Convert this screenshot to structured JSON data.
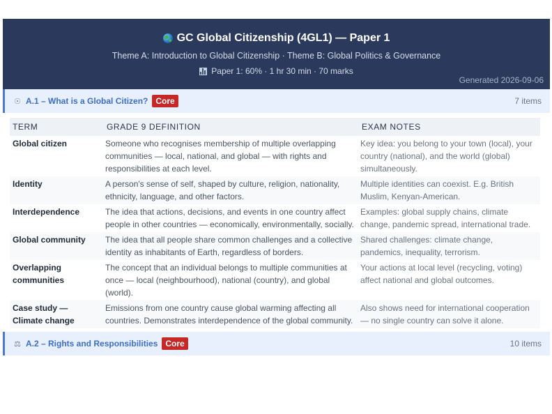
{
  "header": {
    "title": "GC Global Citizenship (4GL1) — Paper 1",
    "subtitle": "Theme A: Introduction to Global Citizenship · Theme B: Global Politics & Governance",
    "meta": "Paper 1: 60% · 1 hr 30 min · 70 marks",
    "generated": "Generated 2026-09-06",
    "title_icon": "globe-icon",
    "meta_icon": "bar-chart-icon"
  },
  "sections": [
    {
      "icon": "globe-meridian-icon",
      "title": "A.1 – What is a Global Citizen?",
      "badge": "Core",
      "count": "7 items"
    },
    {
      "icon": "scales-icon",
      "title": "A.2 – Rights and Responsibilities",
      "badge": "Core",
      "count": "10 items"
    }
  ],
  "table": {
    "headers": [
      "TERM",
      "GRADE 9 DEFINITION",
      "EXAM NOTES"
    ],
    "rows": [
      {
        "term": "Global citizen",
        "definition": "Someone who recognises membership of multiple overlapping communities — local, national, and global — with rights and responsibilities at each level.",
        "notes": "Key idea: you belong to your town (local), your country (national), and the world (global) simultaneously."
      },
      {
        "term": "Identity",
        "definition": "A person's sense of self, shaped by culture, religion, nationality, ethnicity, language, and other factors.",
        "notes": "Multiple identities can coexist. E.g. British Muslim, Kenyan-American."
      },
      {
        "term": "Interdependence",
        "definition": "The idea that actions, decisions, and events in one country affect people in other countries — economically, environmentally, socially.",
        "notes": "Examples: global supply chains, climate change, pandemic spread, international trade."
      },
      {
        "term": "Global community",
        "definition": "The idea that all people share common challenges and a collective identity as inhabitants of Earth, regardless of borders.",
        "notes": "Shared challenges: climate change, pandemics, inequality, terrorism."
      },
      {
        "term": "Overlapping communities",
        "definition": "The concept that an individual belongs to multiple communities at once — local (neighbourhood), national (country), and global (world).",
        "notes": "Your actions at local level (recycling, voting) affect national and global outcomes."
      },
      {
        "term": "Case study — Climate change",
        "definition": "Emissions from one country cause global warming affecting all countries. Demonstrates interdependence of the global community.",
        "notes": "Also shows need for international cooperation — no single country can solve it alone."
      }
    ]
  },
  "colors": {
    "header_bg": "#2b3a5c",
    "accent": "#3d6ec6",
    "badge": "#c62828"
  }
}
